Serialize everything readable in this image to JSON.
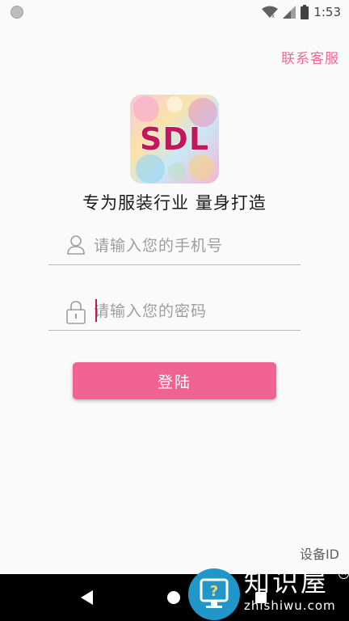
{
  "status_bar": {
    "time": "1:53"
  },
  "header": {
    "support_label": "联系客服"
  },
  "logo": {
    "text": "SDL",
    "brand_color": "#c2185b"
  },
  "slogan": "专为服装行业 量身打造",
  "form": {
    "phone_placeholder": "请输入您的手机号",
    "phone_value": "",
    "password_placeholder": "请输入您的密码",
    "password_value": "",
    "login_label": "登陆"
  },
  "footer": {
    "device_id_label": "设备ID"
  },
  "watermark": {
    "title": "知识屋",
    "domain": "zhishiwu.com"
  },
  "colors": {
    "accent": "#f06292",
    "link": "#ef6b93",
    "caret": "#c2185b"
  }
}
